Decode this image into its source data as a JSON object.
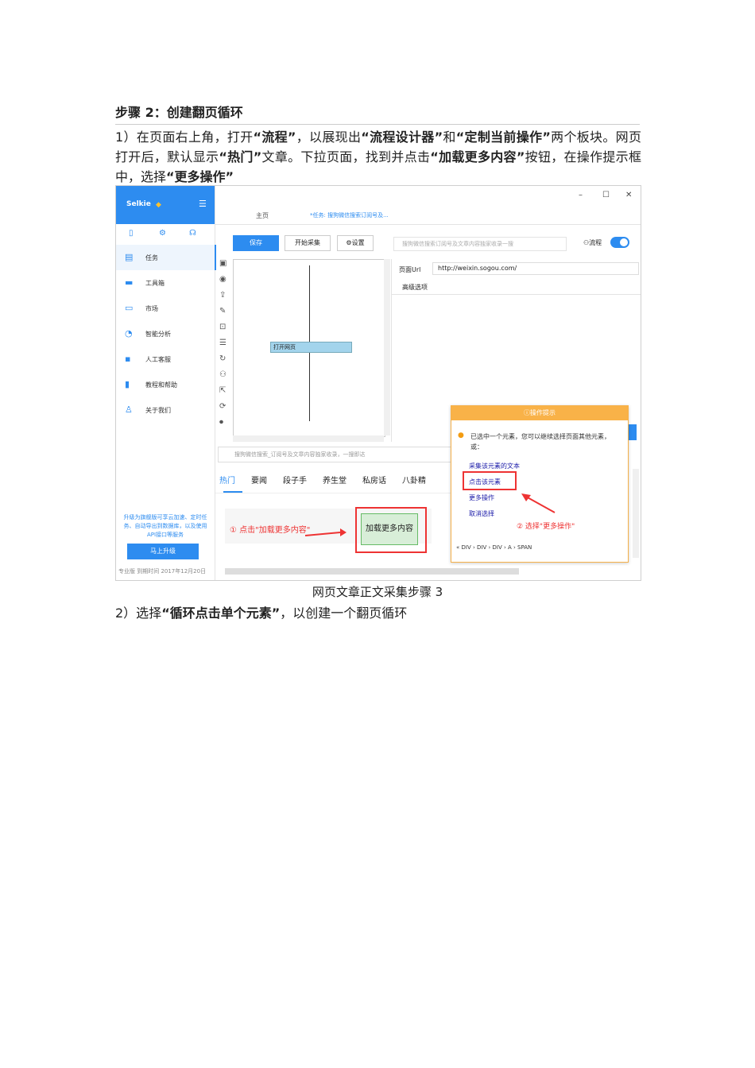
{
  "heading": "步骤 2：创建翻页循环",
  "para1": {
    "p1": "1）在页面右上角，打开",
    "b1": "“流程”",
    "p2": "，以展现出",
    "b2": "“流程设计器”",
    "p3": "和",
    "b3": "“定制当前操作”",
    "p4": "两个板块。网页打开后，默认显示",
    "b4": "“热门”",
    "p5": "文章。下拉页面，找到并点击",
    "b5": "“加载更多内容”",
    "p6": "按钮，在操作提示框中，选择",
    "b6": "“更多操作”"
  },
  "caption": "网页文章正文采集步骤 3",
  "para2": {
    "p1": "2）选择",
    "b1": "“循环点击单个元素”",
    "p2": "，以创建一个翻页循环"
  },
  "app": {
    "brand": "Selkie",
    "menu": [
      "任务",
      "工具箱",
      "市场",
      "智能分析",
      "人工客服",
      "教程和帮助",
      "关于我们"
    ],
    "promo": "升级为旗舰版可享云加速、定时任务、自动导出到数据库，以及使用API接口等服务",
    "upgrade": "马上升级",
    "version": "专业版 到期时间 2017年12月20日",
    "tab_home": "主页",
    "tab_task": "*任务: 搜狗微信搜索订阅号及...",
    "save": "保存",
    "start": "开始采集",
    "settings": "设置",
    "search_placeholder": "搜狗微信搜索订阅号及文章内容独家收录一搜",
    "flow": "流程",
    "node": "打开网页",
    "url_label": "页面Url",
    "url_value": "http://weixin.sogou.com/",
    "advanced": "高级选项",
    "browser_title": "搜狗微信搜索_订阅号及文章内容独家收录，一搜即达",
    "navtabs": [
      "热门",
      "要闻",
      "段子手",
      "养生堂",
      "私房话",
      "八卦精"
    ],
    "annot1": "① 点击\"加载更多内容\"",
    "load_more": "加载更多内容",
    "tip_title": "操作提示",
    "tip_msg": "已选中一个元素，您可以继续选择页面其他元素，或：",
    "tip_links": [
      "采集该元素的文本",
      "点击该元素",
      "更多操作",
      "取消选择"
    ],
    "annot2": "② 选择\"更多操作\"",
    "crumb": "«  DIV  ›  DIV  ›  DIV  ›  A  ›  SPAN"
  }
}
